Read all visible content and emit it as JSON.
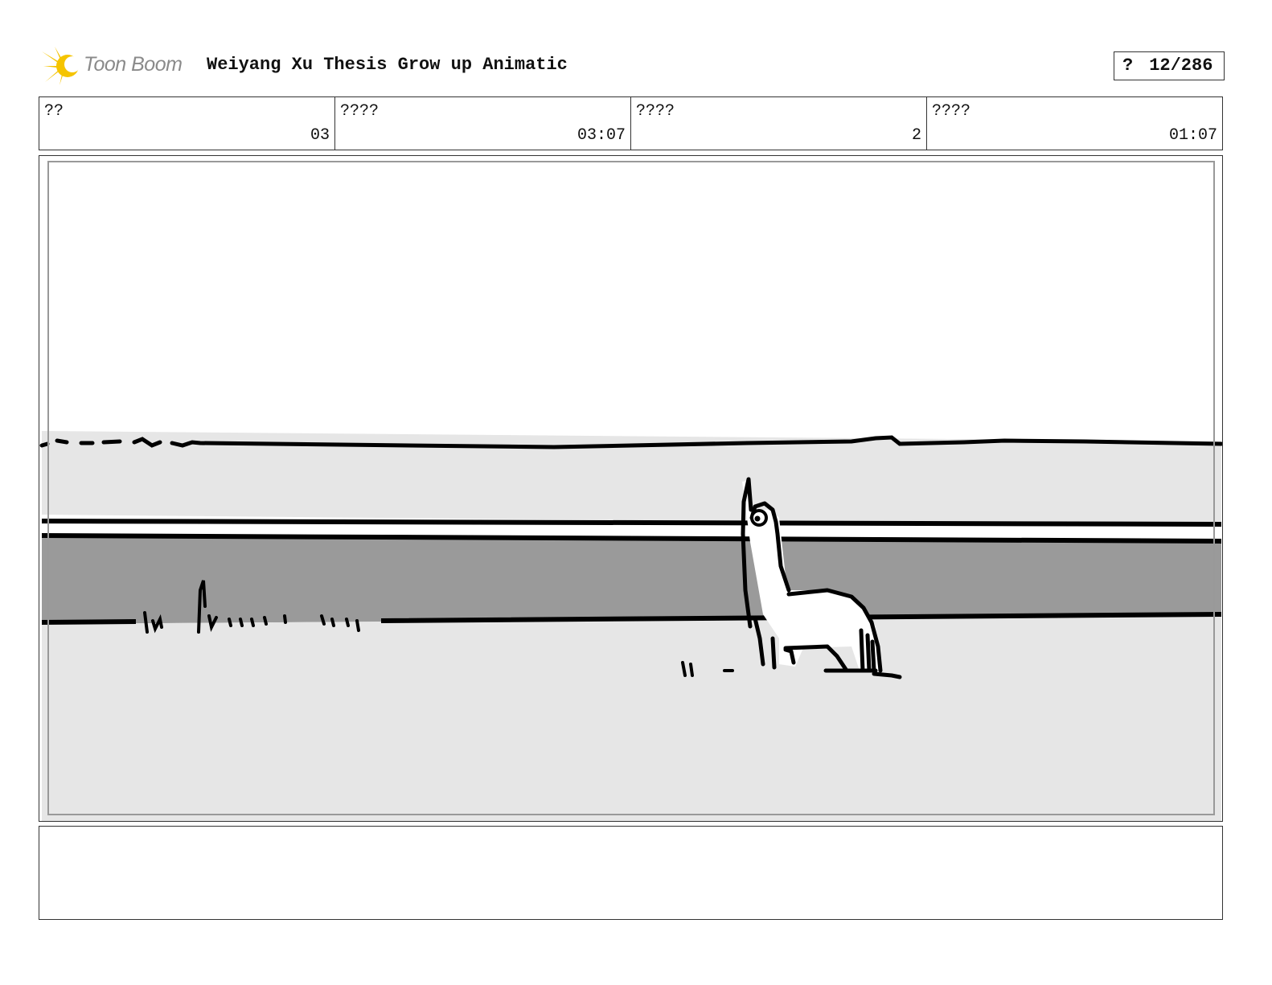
{
  "header": {
    "brand": "Toon Boom",
    "project_title": "Weiyang Xu Thesis Grow up Animatic",
    "page_prefix": "?",
    "page_number": "12/286"
  },
  "info": [
    {
      "label": "??",
      "value": "03"
    },
    {
      "label": "????",
      "value": "03:07"
    },
    {
      "label": "????",
      "value": "2"
    },
    {
      "label": "????",
      "value": "01:07"
    }
  ],
  "colors": {
    "logo_star": "#f5c400",
    "sky": "#ffffff",
    "far_ground": "#e6e6e6",
    "water": "#9a9a9a",
    "near_ground": "#e6e6e6",
    "ink": "#000000"
  },
  "panel": {
    "icon": "llama-sketch"
  },
  "notes": {
    "text": ""
  }
}
